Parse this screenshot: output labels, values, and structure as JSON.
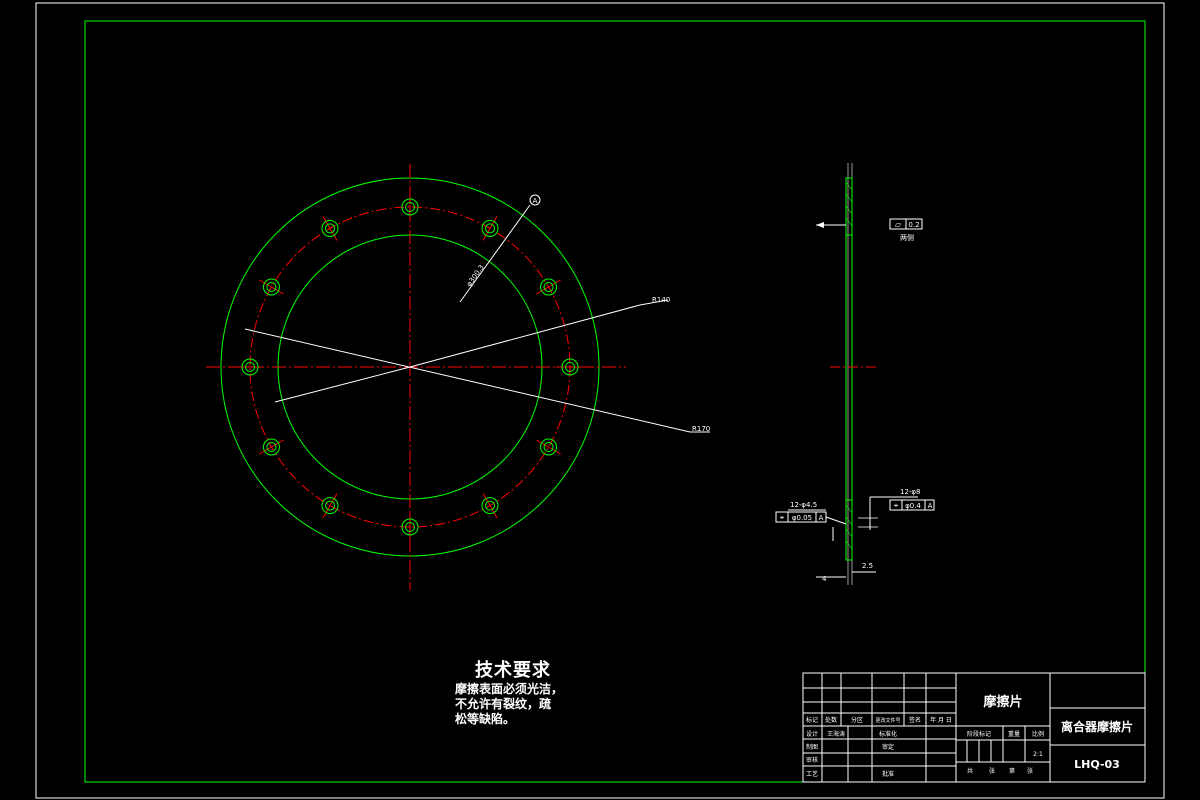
{
  "drawing": {
    "datum_label": "A",
    "dim_pcd": "φ300.3",
    "dim_inner": "R140",
    "dim_outer": "R170",
    "flatness_symbol": "▱",
    "flatness_value": "0.2",
    "flatness_note": "两侧",
    "hole_left_label": "12-φ4.5",
    "hole_left_pos": "φ0.05",
    "hole_left_datum": "A",
    "hole_right_label": "12-φ8",
    "hole_right_pos": "φ0.4",
    "hole_right_datum": "A",
    "thickness_left": "4",
    "thickness_right": "2.5",
    "position_symbol": "⌖"
  },
  "tech_requirements": {
    "heading": "技术要求",
    "lines": [
      "摩擦表面必须光洁，",
      "不允许有裂纹，疏",
      "松等缺陷。"
    ]
  },
  "title_block": {
    "part_name": "摩擦片",
    "assembly_name": "离合器摩擦片",
    "drawing_no": "LHQ-03",
    "scale_value": "2:1",
    "header_labels": [
      "标记",
      "处数",
      "分区",
      "更改文件号",
      "签名",
      "年 月 日"
    ],
    "designer_label": "设计",
    "designer_name": "王海涛",
    "standardization_label": "标准化",
    "drafter_label": "制图",
    "approved_label": "审定",
    "checker_label": "审核",
    "process_label": "工艺",
    "ratify_label": "批准",
    "stage_label": "阶段标记",
    "weight_label": "重量",
    "scale_label": "比例",
    "sheet_labels": [
      "共",
      "张",
      "第",
      "张"
    ]
  },
  "colors": {
    "border": "#ffffff",
    "frame": "#00ff00",
    "circles": "#00ff00",
    "centerline": "#ff0000",
    "dimension": "#ffffff",
    "text": "#ffffff"
  }
}
